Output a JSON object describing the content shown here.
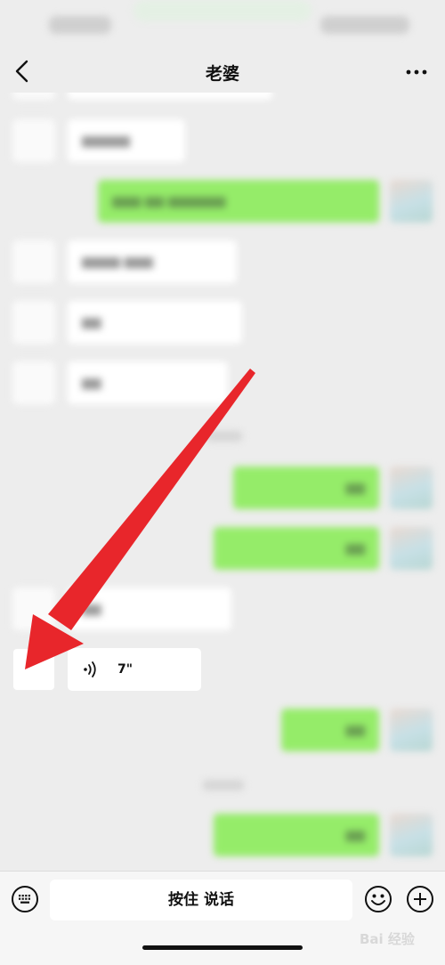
{
  "nav": {
    "title": "老婆"
  },
  "voice_message": {
    "duration": "7\""
  },
  "input": {
    "talk_button_label": "按住 说话"
  },
  "watermark": {
    "text": "Bai 经验"
  },
  "colors": {
    "background": "#ededed",
    "my_bubble": "#95ec69",
    "their_bubble": "#ffffff",
    "annotation_arrow": "#e8262b"
  },
  "icons": {
    "back": "chevron-left-icon",
    "more": "more-dots-icon",
    "voice": "voice-wave-icon",
    "keyboard": "keyboard-icon",
    "emoji": "emoji-icon",
    "plus": "plus-icon"
  }
}
